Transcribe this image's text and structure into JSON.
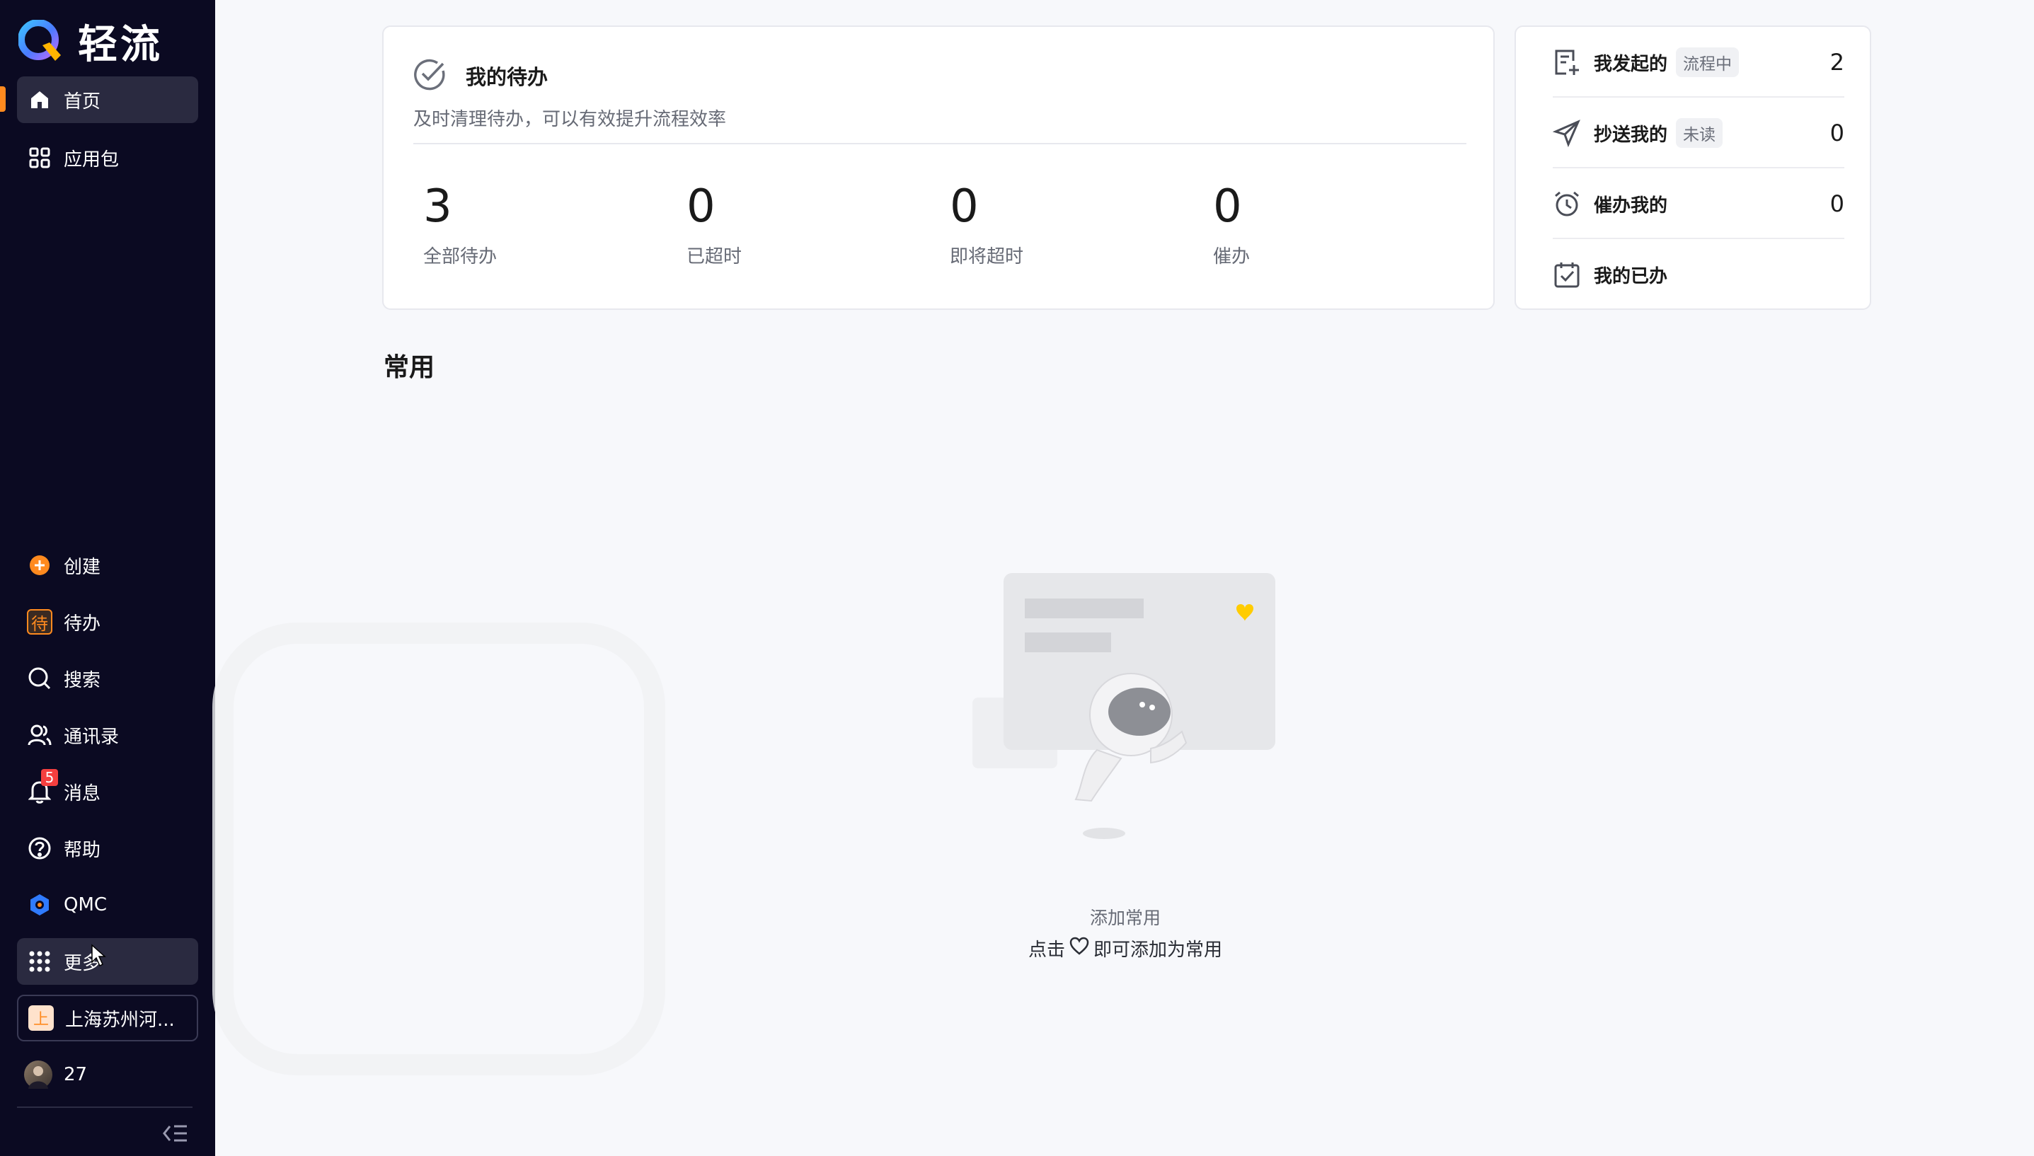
{
  "app": {
    "name": "轻流"
  },
  "sidebar": {
    "top_items": [
      {
        "label": "首页",
        "icon": "home-icon",
        "active": true
      },
      {
        "label": "应用包",
        "icon": "grid-icon",
        "active": false
      }
    ],
    "bottom_items": [
      {
        "label": "创建",
        "icon": "plus-circle-icon"
      },
      {
        "label": "待办",
        "icon": "todo-char-icon",
        "icon_text": "待"
      },
      {
        "label": "搜索",
        "icon": "search-icon"
      },
      {
        "label": "通讯录",
        "icon": "contacts-icon"
      },
      {
        "label": "消息",
        "icon": "bell-icon",
        "badge": "5"
      },
      {
        "label": "帮助",
        "icon": "help-icon"
      },
      {
        "label": "QMC",
        "icon": "qmc-icon"
      },
      {
        "label": "更多",
        "icon": "apps-icon"
      }
    ],
    "workspace": {
      "label": "上海苏州河...",
      "initial": "上"
    },
    "user": {
      "label": "27"
    }
  },
  "todo_card": {
    "title": "我的待办",
    "subtitle": "及时清理待办，可以有效提升流程效率",
    "stats": [
      {
        "value": "3",
        "label": "全部待办"
      },
      {
        "value": "0",
        "label": "已超时"
      },
      {
        "value": "0",
        "label": "即将超时"
      },
      {
        "value": "0",
        "label": "催办"
      }
    ]
  },
  "side_card": {
    "rows": [
      {
        "label": "我发起的",
        "tag": "流程中",
        "count": "2",
        "icon": "new-form-icon"
      },
      {
        "label": "抄送我的",
        "tag": "未读",
        "count": "0",
        "icon": "send-icon"
      },
      {
        "label": "催办我的",
        "tag": "",
        "count": "0",
        "icon": "alarm-clock-icon"
      },
      {
        "label": "我的已办",
        "tag": "",
        "count": "",
        "icon": "calendar-check-icon"
      }
    ]
  },
  "favorites": {
    "title": "常用",
    "empty_title": "添加常用",
    "empty_hint_before": "点击",
    "empty_hint_after": "即可添加为常用"
  },
  "colors": {
    "sidebar_bg": "#0b0a22",
    "accent": "#ff8a1f",
    "badge": "#f53f3f"
  }
}
